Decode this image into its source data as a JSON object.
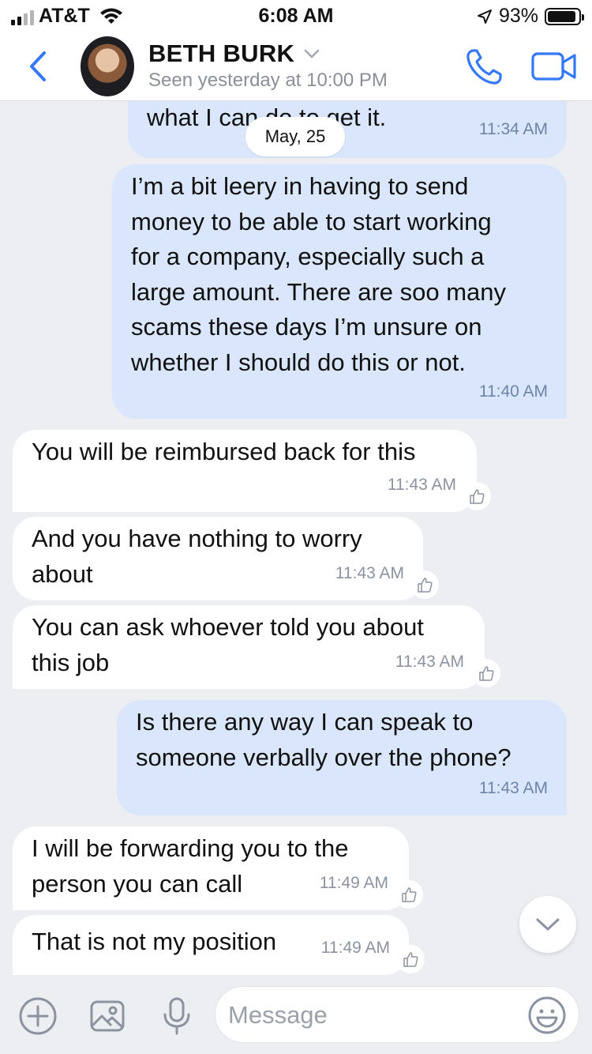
{
  "status_bar": {
    "carrier": "AT&T",
    "time": "6:08 AM",
    "battery": "93%"
  },
  "header": {
    "contact_name": "BETH BURK",
    "seen": "Seen yesterday at 10:00 PM",
    "accent_color": "#3478f6"
  },
  "date_chip": "May, 25",
  "messages": [
    {
      "dir": "out",
      "text": "that exact amount but let me see\nwhat I can do to get it.",
      "time": "11:34 AM"
    },
    {
      "dir": "out",
      "text": "I’m a bit leery in having to send\nmoney to be able to start working\nfor a company, especially such a\nlarge amount. There are soo many\nscams these days I’m unsure on\nwhether I should do this or not.",
      "time": "11:40 AM"
    },
    {
      "dir": "in",
      "text": "You will be reimbursed back for this",
      "time": "11:43 AM"
    },
    {
      "dir": "in",
      "text": "And you have nothing to worry\nabout",
      "time": "11:43 AM"
    },
    {
      "dir": "in",
      "text": "You can ask whoever told you about\nthis job",
      "time": "11:43 AM"
    },
    {
      "dir": "out",
      "text": "Is there any way I can speak to\nsomeone verbally over the phone?",
      "time": "11:43 AM"
    },
    {
      "dir": "in",
      "text": "I will be forwarding you to the\nperson you can call",
      "time": "11:49 AM"
    },
    {
      "dir": "in",
      "text": "That is not my position",
      "time": "11:49 AM"
    }
  ],
  "input": {
    "placeholder": "Message"
  },
  "icons": {
    "back": "chevron-left-icon",
    "call": "phone-icon",
    "video": "video-camera-icon",
    "add": "plus-circle-icon",
    "gallery": "image-icon",
    "mic": "microphone-icon",
    "emoji": "smiley-icon",
    "like": "thumbs-up-icon",
    "scroll": "chevron-down-icon"
  }
}
